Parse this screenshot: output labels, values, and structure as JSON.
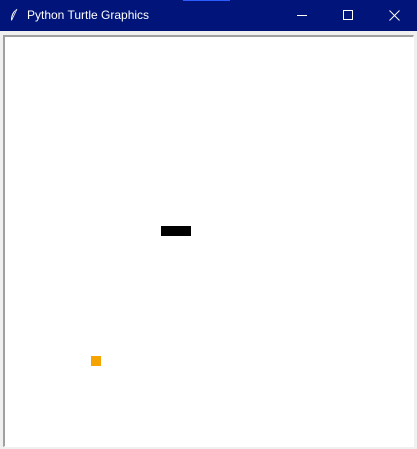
{
  "window": {
    "title": "Python Turtle Graphics",
    "app_icon": "feather-icon",
    "buttons": {
      "minimize_icon": "minimize-icon",
      "maximize_icon": "maximize-icon",
      "close_icon": "close-icon"
    }
  },
  "colors": {
    "titlebar": "#00147a",
    "canvas": "#ffffff",
    "snake": "#000000",
    "food": "#f5a300"
  },
  "canvas": {
    "snake": {
      "shape": "square",
      "segments": 3,
      "color": "#000000"
    },
    "food": {
      "shape": "square",
      "color": "#f5a300"
    }
  }
}
